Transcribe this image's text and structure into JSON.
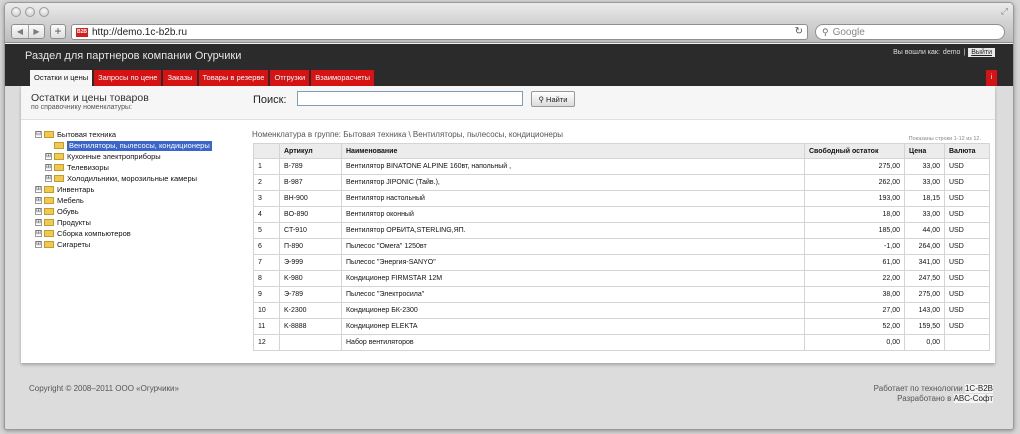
{
  "browser": {
    "url": "http://demo.1c-b2b.ru",
    "search_placeholder": "Google",
    "favicon_text": "B2B"
  },
  "header": {
    "title": "Раздел для партнеров компании Огурчики",
    "login_label": "Вы вошли как:",
    "user": "demo",
    "separator": "|",
    "logout": "Выйти"
  },
  "tabs": [
    {
      "label": "Остатки и цены"
    },
    {
      "label": "Запросы по цене"
    },
    {
      "label": "Заказы"
    },
    {
      "label": "Товары в резерве"
    },
    {
      "label": "Отгрузки"
    },
    {
      "label": "Взаиморасчеты"
    }
  ],
  "info_button": "i",
  "section": {
    "title": "Остатки и цены товаров",
    "subtitle": "по справочнику номенклатуры:",
    "search_label": "Поиск:",
    "search_value": "",
    "find_button": "Найти"
  },
  "tree": [
    {
      "label": "Бытовая техника",
      "toggle": "⊟",
      "level": 0
    },
    {
      "label": "Вентиляторы, пылесосы, кондиционеры",
      "toggle": "",
      "level": 1,
      "selected": true
    },
    {
      "label": "Кухонные электроприборы",
      "toggle": "⊞",
      "level": 1
    },
    {
      "label": "Телевизоры",
      "toggle": "⊞",
      "level": 1
    },
    {
      "label": "Холодильники, морозильные камеры",
      "toggle": "⊞",
      "level": 1
    },
    {
      "label": "Инвентарь",
      "toggle": "⊞",
      "level": 0
    },
    {
      "label": "Мебель",
      "toggle": "⊞",
      "level": 0
    },
    {
      "label": "Обувь",
      "toggle": "⊞",
      "level": 0
    },
    {
      "label": "Продукты",
      "toggle": "⊞",
      "level": 0
    },
    {
      "label": "Сборка компьютеров",
      "toggle": "⊞",
      "level": 0
    },
    {
      "label": "Сигареты",
      "toggle": "⊞",
      "level": 0
    }
  ],
  "breadcrumb": "Номенклатура в группе: Бытовая техника \\ Вентиляторы, пылесосы, кондиционеры",
  "rows_info": "Показаны строки 1-12 из 12.",
  "table": {
    "headers": [
      "",
      "Артикул",
      "Наименование",
      "Свободный остаток",
      "Цена",
      "Валюта"
    ],
    "rows": [
      [
        "1",
        "B-789",
        "Вентилятор BINATONE ALPINE 160вт, напольный ,",
        "275,00",
        "33,00",
        "USD"
      ],
      [
        "2",
        "B-987",
        "Вентилятор JIPONIC (Тайв.),",
        "262,00",
        "33,00",
        "USD"
      ],
      [
        "3",
        "BH-900",
        "Вентилятор настольный",
        "193,00",
        "18,15",
        "USD"
      ],
      [
        "4",
        "BO-890",
        "Вентилятор оконный",
        "18,00",
        "33,00",
        "USD"
      ],
      [
        "5",
        "CT-910",
        "Вентилятор ОРБИТА,STERLING,ЯП.",
        "185,00",
        "44,00",
        "USD"
      ],
      [
        "6",
        "П-890",
        "Пылесос \"Омега\" 1250вт",
        "-1,00",
        "264,00",
        "USD"
      ],
      [
        "7",
        "Э-999",
        "Пылесос \"Энергия-SANYO\"",
        "61,00",
        "341,00",
        "USD"
      ],
      [
        "8",
        "K-980",
        "Кондиционер FIRMSTAR 12M",
        "22,00",
        "247,50",
        "USD"
      ],
      [
        "9",
        "Э-789",
        "Пылесос \"Электросила\"",
        "38,00",
        "275,00",
        "USD"
      ],
      [
        "10",
        "K-2300",
        "Кондиционер БК-2300",
        "27,00",
        "143,00",
        "USD"
      ],
      [
        "11",
        "K-8888",
        "Кондиционер ELEKTA",
        "52,00",
        "159,50",
        "USD"
      ],
      [
        "12",
        "",
        "Набор вентиляторов",
        "0,00",
        "0,00",
        ""
      ]
    ]
  },
  "footer": {
    "copyright": "Copyright © 2008–2011 ООО «Огурчики»",
    "powered_prefix": "Работает по технологии",
    "powered_link": "1С-B2B",
    "dev_prefix": "Разработано в",
    "dev_link": "ABC-Софт"
  },
  "colors": {
    "tab_red": "#d61212",
    "header_bg": "#2b2b2b",
    "selected": "#3a65c9"
  }
}
